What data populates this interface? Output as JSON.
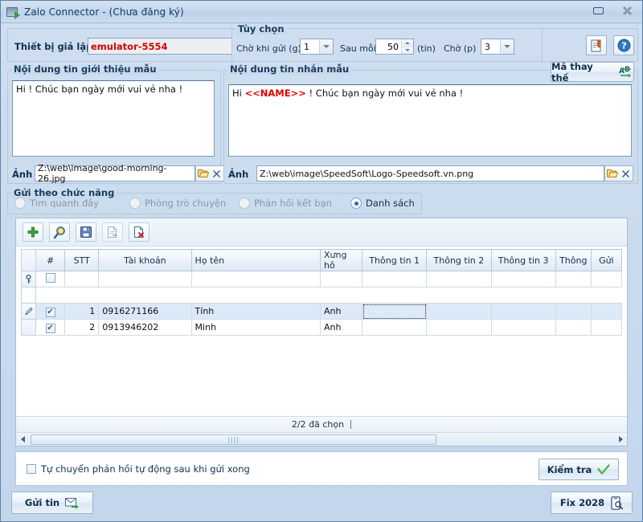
{
  "window": {
    "title": "Zalo Connector  -  (Chưa đăng ký)",
    "icon": "app-screen-arrow-icon",
    "minimize_label": "–",
    "close_label": "✕"
  },
  "device": {
    "label": "Thiết bị giả lập",
    "value": "emulator-5554",
    "value_color": "#d40000"
  },
  "options": {
    "title": "Tùy chọn",
    "wait_send_label": "Chờ khi gửi (g)",
    "wait_send_value": "1",
    "after_each_label": "Sau mỗi",
    "after_each_value": "50",
    "after_each_unit": "(tin)",
    "wait_minutes_label": "Chờ  (p)",
    "wait_minutes_value": "3",
    "report_icon": "report-icon",
    "help_icon": "help-icon"
  },
  "intro": {
    "title": "Nội dung tin giới thiệu mẫu",
    "text": "Hi ! Chúc bạn ngày mới vui vẻ nha !",
    "image_label": "Ảnh",
    "image_path": "Z:\\web\\image\\good-morning-26.jpg",
    "browse_icon": "folder-open-icon",
    "clear_icon": "close-icon"
  },
  "message": {
    "title": "Nội dung tin nhắn mẫu",
    "text_prefix": "Hi ",
    "text_token": "<<NAME>>",
    "text_suffix": " ! Chúc bạn ngày mới vui vẻ nha !",
    "image_label": "Ảnh",
    "image_path": "Z:\\web\\image\\SpeedSoft\\Logo-Speedsoft.vn.png",
    "browse_icon": "folder-open-icon",
    "clear_icon": "close-icon",
    "replace_code_button": "Mã thay thế",
    "replace_code_icon": "ab-swap-icon"
  },
  "send_mode": {
    "title": "Gửi theo chức năng",
    "options": [
      {
        "label": "Tìm quanh đây",
        "selected": false,
        "enabled": false
      },
      {
        "label": "Phòng trò chuyện",
        "selected": false,
        "enabled": false
      },
      {
        "label": "Phản hồi kết bạn",
        "selected": false,
        "enabled": false
      },
      {
        "label": "Danh sách",
        "selected": true,
        "enabled": true
      }
    ]
  },
  "toolbar": {
    "buttons": [
      {
        "name": "add-icon",
        "title": ""
      },
      {
        "name": "search-icon",
        "title": ""
      },
      {
        "name": "save-icon",
        "title": ""
      },
      {
        "name": "export-page-icon",
        "title": ""
      },
      {
        "name": "delete-icon",
        "title": ""
      }
    ]
  },
  "grid": {
    "columns": [
      "#",
      "STT",
      "Tài khoản",
      "Họ tên",
      "Xưng hô",
      "Thông tin 1",
      "Thông tin 2",
      "Thông tin 3",
      "Thông",
      "Gửi"
    ],
    "filter_row": {
      "key_icon": "key-icon",
      "checkbox_checked": false
    },
    "rows": [
      {
        "indicator": "edit-pencil-icon",
        "checked": true,
        "stt": "1",
        "account": "0916271166",
        "name": "Tính",
        "title": "Anh",
        "info1": "",
        "info2": "",
        "info3": "",
        "info4": "",
        "send": "",
        "selected": true
      },
      {
        "indicator": "",
        "checked": true,
        "stt": "2",
        "account": "0913946202",
        "name": "Minh",
        "title": "Anh",
        "info1": "",
        "info2": "",
        "info3": "",
        "info4": "",
        "send": "",
        "selected": false
      }
    ],
    "status": "2/2 đã chọn"
  },
  "footer": {
    "auto_forward_label": "Tự chuyển phản hồi tự động sau khi gửi xong",
    "auto_forward_checked": false,
    "check_button": "Kiểm tra",
    "check_icon": "check-mark-icon",
    "send_button": "Gửi tin",
    "send_icon": "envelope-send-icon",
    "fix_button": "Fix 2028",
    "fix_icon": "phone-search-icon"
  }
}
